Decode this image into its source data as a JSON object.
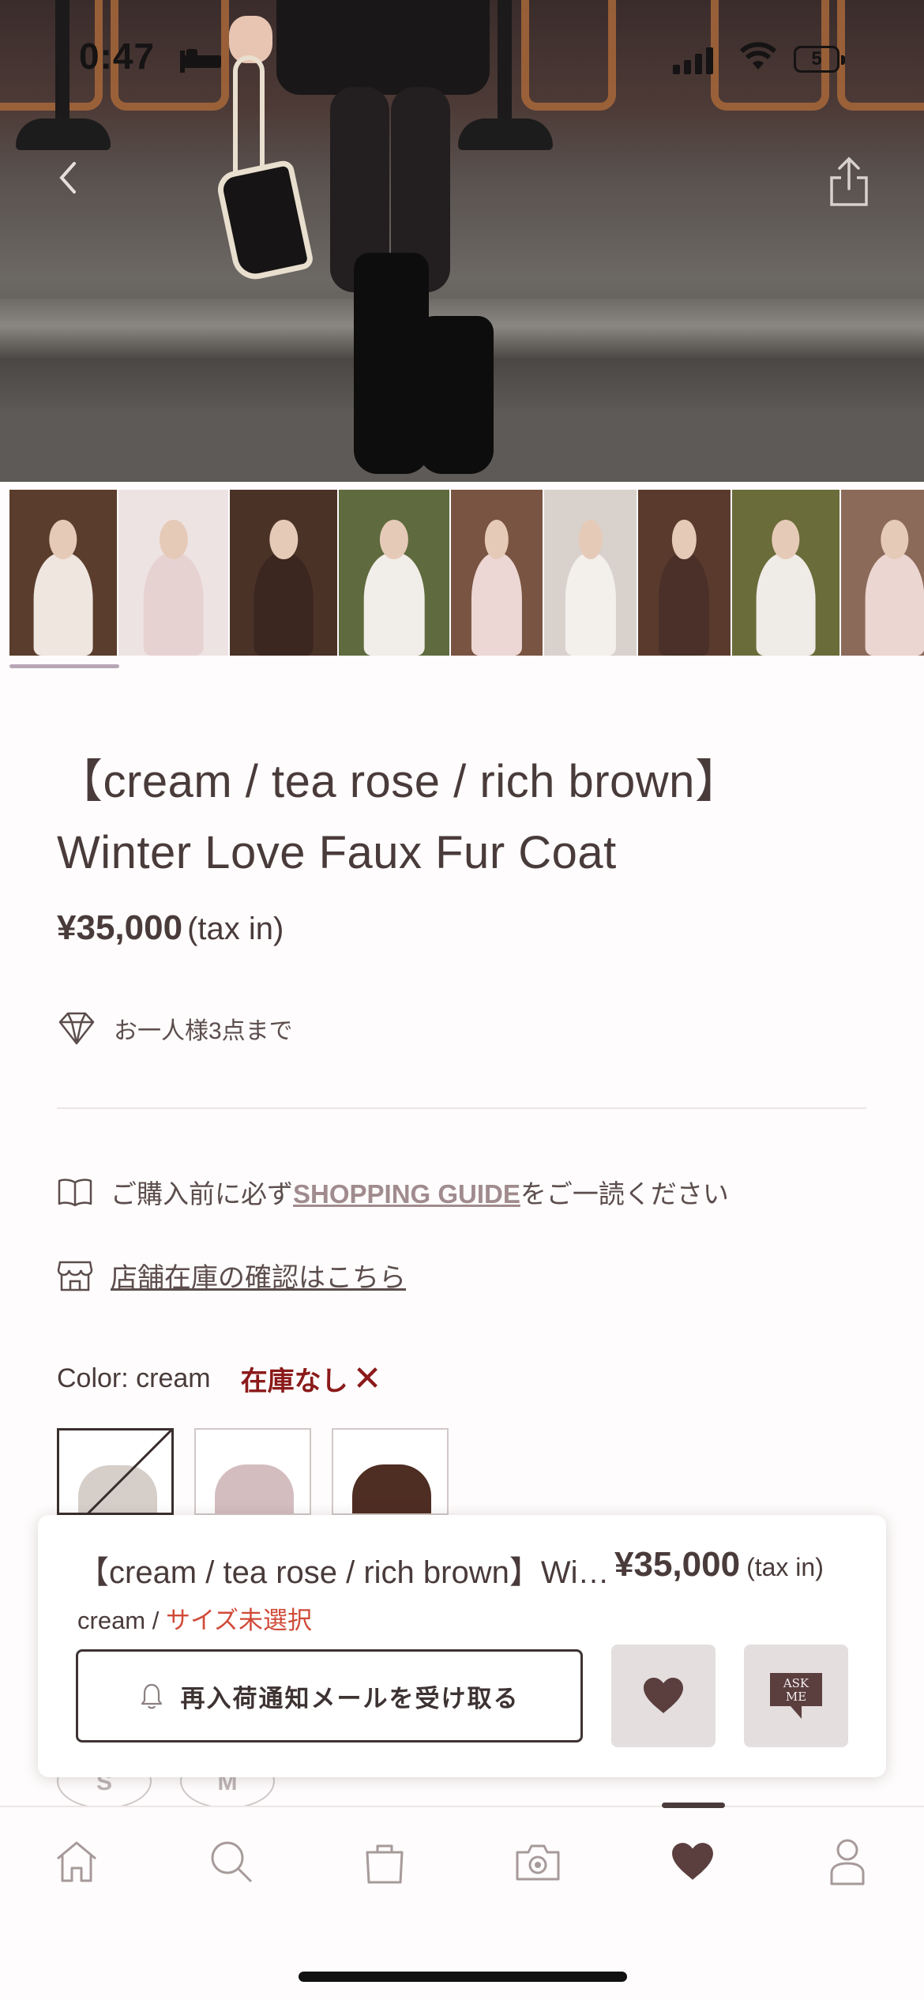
{
  "status_bar": {
    "time": "0:47",
    "battery": "5"
  },
  "product": {
    "title_line1": "【cream / tea rose / rich brown】",
    "title_line2": "Winter Love Faux Fur Coat",
    "price": "¥35,000",
    "tax": "(tax in)",
    "limit_text": "お一人様3点まで"
  },
  "info": {
    "guide_prefix": "ご購入前に必ず",
    "guide_link": "SHOPPING GUIDE",
    "guide_suffix": "をご一読ください",
    "store_link": "店舗在庫の確認はこちら"
  },
  "color": {
    "label": "Color: cream",
    "status": "在庫なし",
    "swatches": [
      "cream",
      "tea rose",
      "rich brown"
    ]
  },
  "sizes": [
    "S",
    "M"
  ],
  "card": {
    "name": "【cream / tea rose / rich brown】Winter Love Faux Fur Coat",
    "price": "¥35,000",
    "tax": "(tax in)",
    "selected_color": "cream /",
    "size_warning": "サイズ未選択",
    "notify_label": "再入荷通知メールを受け取る",
    "ask_label_1": "ASK",
    "ask_label_2": "ME"
  },
  "thumbnails": [
    {
      "bg": "#5a3d2c",
      "coat": "#efe6e0"
    },
    {
      "bg": "#eee3e3",
      "coat": "#e7d2d2"
    },
    {
      "bg": "#4b3227",
      "coat": "#3b2620"
    },
    {
      "bg": "#5f6a3e",
      "coat": "#f1ede8"
    },
    {
      "bg": "#7a5442",
      "coat": "#ecd7d4"
    },
    {
      "bg": "#d9d2cc",
      "coat": "#f3f0ec"
    },
    {
      "bg": "#5a3a2c",
      "coat": "#4a3028"
    },
    {
      "bg": "#6a6c3a",
      "coat": "#efebe6"
    },
    {
      "bg": "#8c6a5a",
      "coat": "#ecd6d2"
    }
  ],
  "colors": {
    "text": "#4a3b3b",
    "accent_link": "#a08b8e",
    "out_of_stock": "#8b1a1a",
    "warning": "#d04a38"
  },
  "tabs": [
    "home-icon",
    "search-icon",
    "bag-icon",
    "camera-icon",
    "heart-icon",
    "user-icon"
  ]
}
